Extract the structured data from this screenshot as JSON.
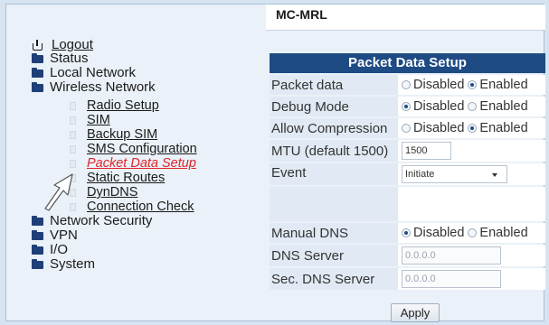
{
  "device": {
    "title": "MC-MRL"
  },
  "sidebar": {
    "logout": "Logout",
    "top_items": [
      "Status",
      "Local Network",
      "Wireless Network"
    ],
    "sub_items": [
      "Radio Setup",
      "SIM",
      "Backup SIM",
      "SMS Configuration",
      "Packet Data Setup",
      "Static Routes",
      "DynDNS",
      "Connection Check"
    ],
    "active_sub": "Packet Data Setup",
    "bottom_items": [
      "Network Security",
      "VPN",
      "I/O",
      "System"
    ]
  },
  "panel": {
    "title": "Packet Data Setup",
    "rows": {
      "packet_data": {
        "label": "Packet data",
        "options": [
          "Disabled",
          "Enabled"
        ],
        "selected": "Enabled"
      },
      "debug_mode": {
        "label": "Debug Mode",
        "options": [
          "Disabled",
          "Enabled"
        ],
        "selected": "Disabled"
      },
      "allow_compression": {
        "label": "Allow Compression",
        "options": [
          "Disabled",
          "Enabled"
        ],
        "selected": "Enabled"
      },
      "mtu": {
        "label": "MTU (default 1500)",
        "value": "1500"
      },
      "event": {
        "label": "Event",
        "value": "Initiate"
      },
      "manual_dns": {
        "label": "Manual DNS",
        "options": [
          "Disabled",
          "Enabled"
        ],
        "selected": "Disabled"
      },
      "dns_server": {
        "label": "DNS Server",
        "value": "0.0.0.0"
      },
      "sec_dns_server": {
        "label": "Sec. DNS Server",
        "value": "0.0.0.0"
      }
    },
    "apply_label": "Apply"
  },
  "icons": {
    "logout": "logout-icon",
    "folder": "folder-icon",
    "pointer": "arrow-pointer-icon"
  },
  "colors": {
    "header": "#1e4b84",
    "active_link": "#e0252b",
    "folder": "#1f3f78"
  }
}
